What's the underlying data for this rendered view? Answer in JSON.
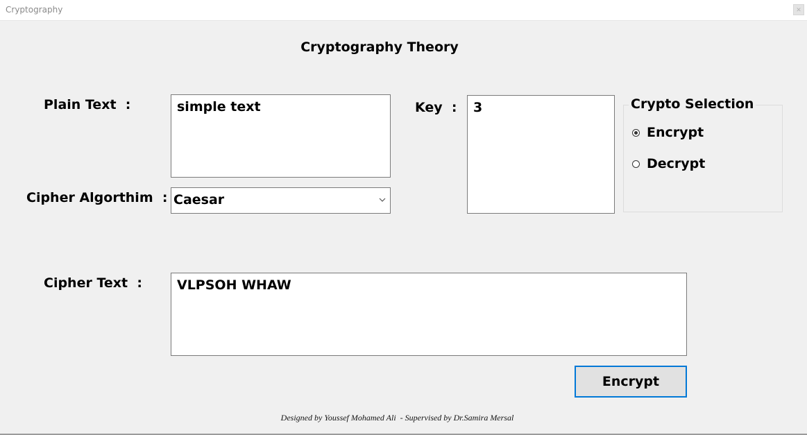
{
  "window": {
    "title": "Cryptography"
  },
  "app": {
    "title": "Cryptography Theory"
  },
  "form": {
    "plain_text_label": "Plain Text  :",
    "plain_text_value": "simple text",
    "key_label": "Key  :",
    "key_value": "3",
    "cipher_algorithm_label": "Cipher Algorthim  :",
    "cipher_algorithm_value": "Caesar",
    "cipher_text_label": "Cipher Text  :",
    "cipher_text_value": "VLPSOH WHAW"
  },
  "crypto_selection": {
    "title": "Crypto Selection",
    "options": [
      {
        "label": "Encrypt",
        "selected": true
      },
      {
        "label": "Decrypt",
        "selected": false
      }
    ]
  },
  "actions": {
    "encrypt_button_label": "Encrypt"
  },
  "footer": {
    "credits": "Designed by Youssef Mohamed Ali  - Supervised by Dr.Samira Mersal"
  },
  "icons": {
    "dropdown": "chevron-down-icon",
    "close": "close-icon"
  },
  "colors": {
    "background": "#f0f0f0",
    "accent_border": "#0078d7",
    "button_fill": "#e1e1e1"
  }
}
